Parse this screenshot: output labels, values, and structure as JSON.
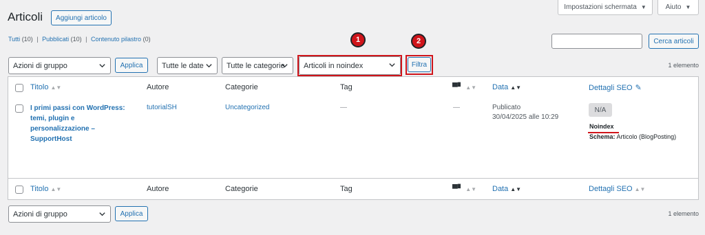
{
  "screen_options": "Impostazioni schermata",
  "help": "Aiuto",
  "page_title": "Articoli",
  "add_new": "Aggiungi articolo",
  "views": {
    "all": "Tutti",
    "all_count": "(10)",
    "sep1": "|",
    "published": "Pubblicati",
    "published_count": "(10)",
    "sep2": "|",
    "cornerstone": "Contenuto pilastro",
    "cornerstone_count": "(0)"
  },
  "search": {
    "button": "Cerca articoli",
    "value": ""
  },
  "bulk_top": "Azioni di gruppo",
  "apply_top": "Applica",
  "date_filter": "Tutte le date",
  "cat_filter": "Tutte le categorie",
  "seo_filter": "Articoli in noindex",
  "filter_button": "Filtra",
  "items_top": "1 elemento",
  "markers": {
    "one": "1",
    "two": "2"
  },
  "columns": {
    "title": "Titolo",
    "author": "Autore",
    "categories": "Categorie",
    "tags": "Tag",
    "date": "Data",
    "seo": "Dettagli SEO"
  },
  "row": {
    "title": "I primi passi con WordPress: temi, plugin e personalizzazione – SupportHost",
    "author": "tutorialSH",
    "category": "Uncategorized",
    "tags": "—",
    "comments": "—",
    "status": "Publicato",
    "date": "30/04/2025 alle 10:29",
    "seo_score": "N/A",
    "noindex": "Noindex",
    "schema_label": "Schema:",
    "schema_value": "Articolo (BlogPosting)"
  },
  "bulk_bottom": "Azioni di gruppo",
  "apply_bottom": "Applica",
  "items_bottom": "1 elemento",
  "colors": {
    "accent": "#2271b1",
    "annotation": "#d0141a"
  }
}
